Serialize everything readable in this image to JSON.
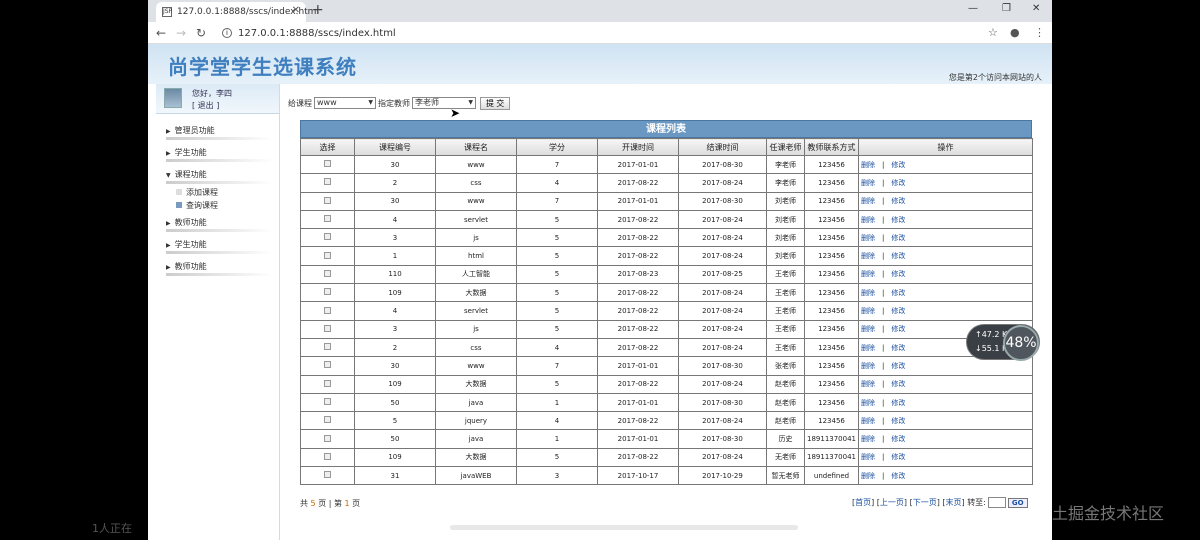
{
  "browser": {
    "tab_title": "127.0.0.1:8888/sscs/index.html",
    "tab_favicon": "JSP",
    "url": "127.0.0.1:8888/sscs/index.html"
  },
  "header": {
    "logo_text": "尚学堂学生选课系统",
    "visits_text": "您是第2个访问本网站的人"
  },
  "user": {
    "greeting": "您好，李四",
    "logout": "[ 退出 ]"
  },
  "sidebar": {
    "items": [
      {
        "label": "管理员功能"
      },
      {
        "label": "学生功能"
      },
      {
        "label": "课程功能"
      },
      {
        "label": "教师功能"
      },
      {
        "label": "学生功能"
      },
      {
        "label": "教师功能"
      }
    ],
    "submenu": [
      {
        "label": "添加课程"
      },
      {
        "label": "查询课程"
      }
    ]
  },
  "filter": {
    "course_label": "给课程",
    "course_value": "www",
    "teacher_label": "指定教师",
    "teacher_value": "李老师",
    "submit_label": "提 交"
  },
  "table": {
    "title": "课程列表",
    "headers": [
      "选择",
      "课程编号",
      "课程名",
      "学分",
      "开课时间",
      "结课时间",
      "任课老师",
      "教师联系方式",
      "操作"
    ],
    "delete_label": "删除",
    "edit_label": "修改",
    "rows": [
      [
        "30",
        "www",
        "7",
        "2017-01-01",
        "2017-08-30",
        "李老师",
        "123456"
      ],
      [
        "2",
        "css",
        "4",
        "2017-08-22",
        "2017-08-24",
        "李老师",
        "123456"
      ],
      [
        "30",
        "www",
        "7",
        "2017-01-01",
        "2017-08-30",
        "刘老师",
        "123456"
      ],
      [
        "4",
        "servlet",
        "5",
        "2017-08-22",
        "2017-08-24",
        "刘老师",
        "123456"
      ],
      [
        "3",
        "js",
        "5",
        "2017-08-22",
        "2017-08-24",
        "刘老师",
        "123456"
      ],
      [
        "1",
        "html",
        "5",
        "2017-08-22",
        "2017-08-24",
        "刘老师",
        "123456"
      ],
      [
        "110",
        "人工智能",
        "5",
        "2017-08-23",
        "2017-08-25",
        "王老师",
        "123456"
      ],
      [
        "109",
        "大数据",
        "5",
        "2017-08-22",
        "2017-08-24",
        "王老师",
        "123456"
      ],
      [
        "4",
        "servlet",
        "5",
        "2017-08-22",
        "2017-08-24",
        "王老师",
        "123456"
      ],
      [
        "3",
        "js",
        "5",
        "2017-08-22",
        "2017-08-24",
        "王老师",
        "123456"
      ],
      [
        "2",
        "css",
        "4",
        "2017-08-22",
        "2017-08-24",
        "王老师",
        "123456"
      ],
      [
        "30",
        "www",
        "7",
        "2017-01-01",
        "2017-08-30",
        "张老师",
        "123456"
      ],
      [
        "109",
        "大数据",
        "5",
        "2017-08-22",
        "2017-08-24",
        "赵老师",
        "123456"
      ],
      [
        "50",
        "java",
        "1",
        "2017-01-01",
        "2017-08-30",
        "赵老师",
        "123456"
      ],
      [
        "5",
        "jquery",
        "4",
        "2017-08-22",
        "2017-08-24",
        "赵老师",
        "123456"
      ],
      [
        "50",
        "java",
        "1",
        "2017-01-01",
        "2017-08-30",
        "历史",
        "18911370041"
      ],
      [
        "109",
        "大数据",
        "5",
        "2017-08-22",
        "2017-08-24",
        "无老师",
        "18911370041"
      ],
      [
        "31",
        "javaWEB",
        "3",
        "2017-10-17",
        "2017-10-29",
        "暂无老师",
        "undefined"
      ]
    ]
  },
  "pager": {
    "total_prefix": "共",
    "total_pages": "5",
    "total_suffix": "页",
    "sep": "|",
    "current_prefix": "第",
    "current_page": "1",
    "current_suffix": "页",
    "first": "首页",
    "prev": "上一页",
    "next": "下一页",
    "last": "末页",
    "goto_label": "转至:",
    "go": "GO"
  },
  "overlay": {
    "upload_speed": "↑47.2 K/s",
    "download_speed": "↓55.1 K/s",
    "percent": "48%",
    "viewers": "1人正在",
    "watermark": "@稀土掘金技术社区"
  }
}
